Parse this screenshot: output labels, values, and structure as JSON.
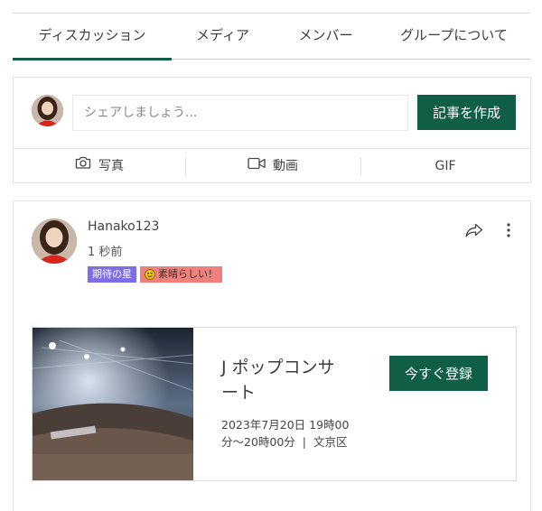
{
  "tabs": [
    {
      "label": "ディスカッション",
      "active": true
    },
    {
      "label": "メディア"
    },
    {
      "label": "メンバー"
    },
    {
      "label": "グループについて"
    }
  ],
  "composer": {
    "placeholder": "シェアしましょう...",
    "create_button": "記事を作成",
    "actions": [
      {
        "label": "写真",
        "icon": "camera-icon"
      },
      {
        "label": "動画",
        "icon": "video-icon"
      },
      {
        "label": "GIF"
      }
    ]
  },
  "post": {
    "author": "Hanako123",
    "timestamp": "1 秒前",
    "badges": [
      {
        "label": "期待の星"
      },
      {
        "label": "素晴らしい！",
        "icon": "smile-icon"
      }
    ],
    "event": {
      "title": "J ポップコンサート",
      "datetime": "2023年7月20日 19時00分〜20時00分",
      "separator": "|",
      "location": "文京区",
      "register_button": "今すぐ登録"
    }
  },
  "colors": {
    "accent": "#115e47",
    "badge_purple": "#7d6ee6",
    "badge_coral": "#f0807c"
  }
}
